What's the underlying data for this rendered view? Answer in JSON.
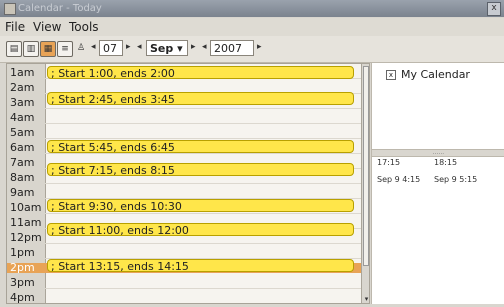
{
  "window": {
    "title": "Calendar - Today",
    "close_glyph": "x"
  },
  "menu": {
    "file": "File",
    "view": "View",
    "tools": "Tools"
  },
  "toolbar": {
    "icons": [
      "day-view-icon",
      "week-view-icon",
      "month-view-icon",
      "list-view-icon",
      "user-icon"
    ],
    "day": "07",
    "month": "Sep",
    "year": "2007",
    "arrow_left": "◂",
    "arrow_right": "▸",
    "dropdown": "▾"
  },
  "hours": [
    "1am",
    "2am",
    "3am",
    "4am",
    "5am",
    "6am",
    "7am",
    "8am",
    "9am",
    "10am",
    "11am",
    "12pm",
    "1pm",
    "2pm",
    "3pm",
    "4pm"
  ],
  "selected_hour": "2pm",
  "events": [
    {
      "label": "; Start 1:00, ends 2:00"
    },
    {
      "label": "; Start 2:45, ends 3:45"
    },
    {
      "label": "; Start 5:45, ends 6:45"
    },
    {
      "label": "; Start 7:15, ends 8:15"
    },
    {
      "label": "; Start 9:30, ends 10:30"
    },
    {
      "label": "; Start 11:00, ends 12:00"
    },
    {
      "label": "; Start 13:15, ends 14:15"
    }
  ],
  "calendars": [
    {
      "name": "My Calendar",
      "checked": true,
      "check_glyph": "x"
    }
  ],
  "divider_glyph": "......",
  "alarms": {
    "times": [
      "17:15",
      "18:15"
    ],
    "ranges": [
      "Sep 9 4:15",
      "Sep 9 5:15"
    ]
  },
  "scroll_down_glyph": "▾",
  "colors": {
    "event_fill": "#ffe64a",
    "event_border": "#b8a000",
    "selected_row": "#e8a356"
  }
}
